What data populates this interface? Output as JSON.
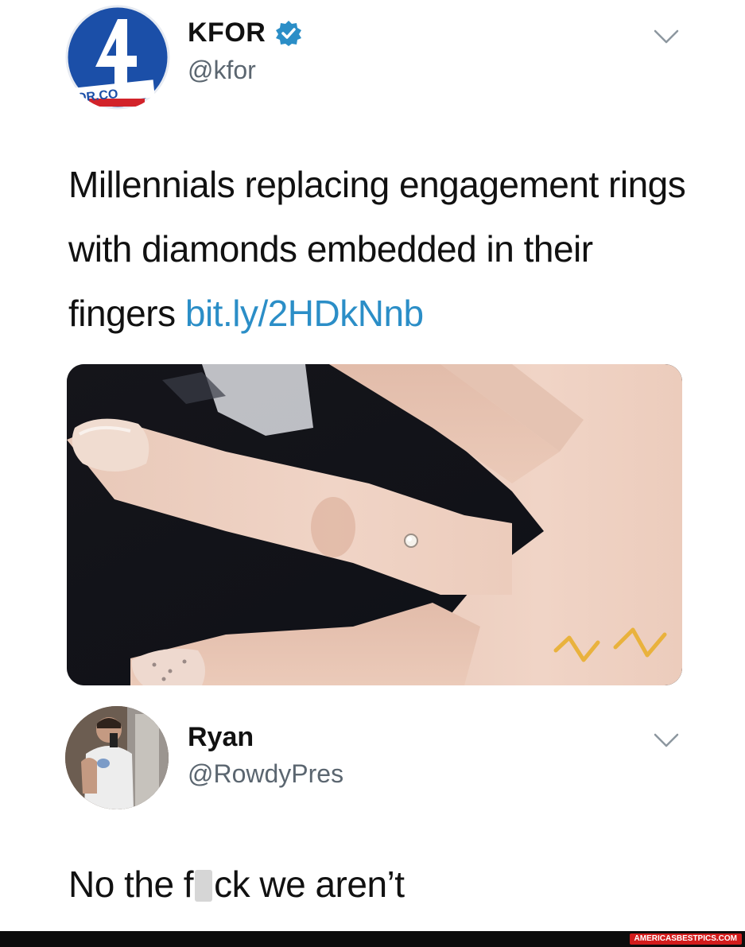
{
  "tweet": {
    "display_name": "KFOR",
    "handle": "@kfor",
    "text_main": "Millennials replacing engagement rings with diamonds embedded in their fingers",
    "link": "bit.ly/2HDkNnb",
    "avatar_text": "FOR.CO",
    "verified": true,
    "accent_color": "#2b8ec7"
  },
  "reply": {
    "display_name": "Ryan",
    "handle": "@RowdyPres",
    "text_before": "No the f",
    "text_after": "ck we aren’t"
  },
  "icons": [
    "verified-icon",
    "chevron-down-icon"
  ],
  "watermark": "AMERICASBESTPICS.COM"
}
